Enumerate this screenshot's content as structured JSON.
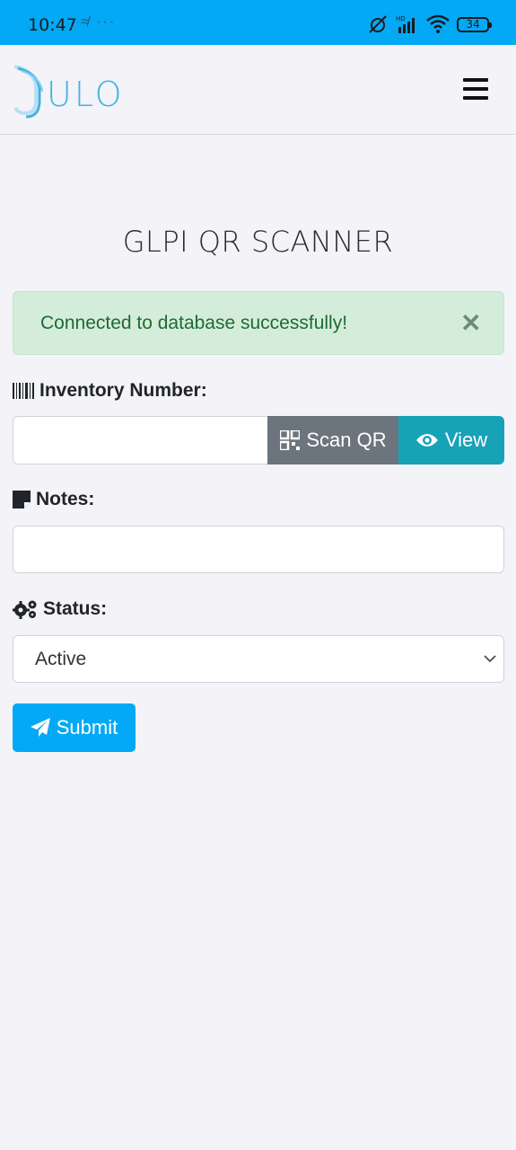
{
  "status_bar": {
    "time": "10:47",
    "left_icons": "≉ ···",
    "battery": "34"
  },
  "navbar": {
    "logo_text": "ULO"
  },
  "page": {
    "title": "GLPI QR SCANNER"
  },
  "alert": {
    "message": "Connected to database successfully!",
    "close": "✕"
  },
  "form": {
    "inventory_label": "Inventory Number:",
    "inventory_value": "",
    "scan_label": "Scan QR",
    "view_label": "View",
    "notes_label": "Notes:",
    "notes_value": "",
    "status_label": "Status:",
    "status_value": "Active",
    "submit_label": "Submit"
  },
  "colors": {
    "status_bar": "#03a9f4",
    "alert_bg": "#d4edda",
    "alert_text": "#1e6a34",
    "scan_btn": "#6c757d",
    "view_btn": "#17a2b8",
    "submit_btn": "#03a9f4",
    "logo": "#43b3e0"
  }
}
